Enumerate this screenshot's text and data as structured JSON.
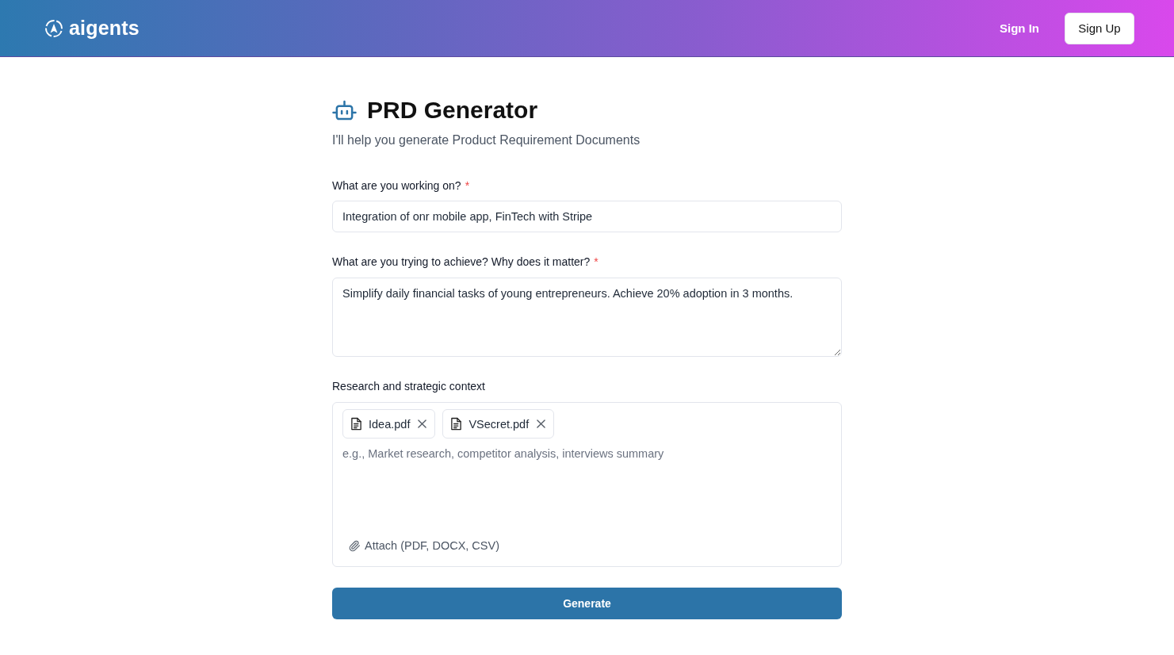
{
  "header": {
    "logo": "aigents",
    "sign_in": "Sign In",
    "sign_up": "Sign Up"
  },
  "page": {
    "title": "PRD Generator",
    "subtitle": "I'll help you generate Product Requirement Documents"
  },
  "fields": [
    {
      "kind": "input",
      "label": "What are you working on?",
      "required_mark": "*",
      "value": "Integration of onr mobile app, FinTech with Stripe"
    },
    {
      "kind": "textarea",
      "label": "What are you trying to achieve? Why does it matter?",
      "required_mark": "*",
      "value": "Simplify daily financial tasks of young entrepreneurs. Achieve 20% adoption in 3 months."
    },
    {
      "kind": "attachments",
      "label": "Research and strategic context",
      "files": [
        {
          "name": "Idea.pdf"
        },
        {
          "name": "VSecret.pdf"
        }
      ],
      "placeholder": "e.g., Market research, competitor analysis, interviews summary",
      "attach_label": "Attach (PDF, DOCX, CSV)"
    }
  ],
  "generate_button": "Generate"
}
